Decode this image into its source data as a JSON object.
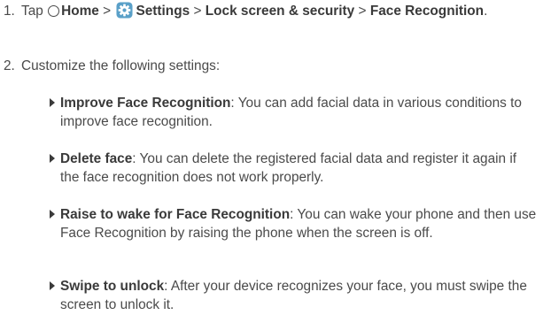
{
  "steps": [
    {
      "number": "1.",
      "tap": "Tap",
      "home_label": "Home",
      "sep1": ">",
      "settings_label": "Settings",
      "sep2": ">",
      "lock_label": "Lock screen & security",
      "sep3": ">",
      "face_label": "Face Recognition",
      "end": "."
    },
    {
      "number": "2.",
      "text": "Customize the following settings:"
    }
  ],
  "bullets": [
    {
      "term": "Improve Face Recognition",
      "desc": ": You can add facial data in various conditions to improve face recognition."
    },
    {
      "term": "Delete face",
      "desc": ": You can delete the registered facial data and register it again if the face recognition does not work properly."
    },
    {
      "term": "Raise to wake for Face Recognition",
      "desc": ": You can wake your phone and then use Face Recognition by raising the phone when the screen is off."
    },
    {
      "term": "Swipe to unlock",
      "desc": ": After your device recognizes your face, you must swipe the screen to unlock it."
    }
  ],
  "icons": {
    "home": "home-icon",
    "settings": "gear-icon",
    "settings_color": "#5aa0c8"
  }
}
